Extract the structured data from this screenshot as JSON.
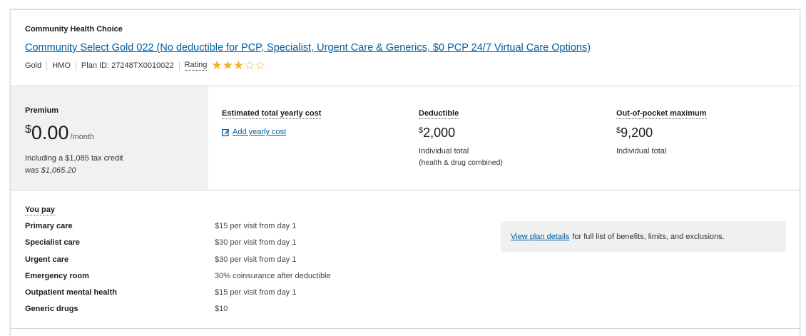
{
  "header": {
    "issuer": "Community Health Choice",
    "plan_name": "Community Select Gold 022 (No deductible for PCP, Specialist, Urgent Care & Generics, $0 PCP 24/7 Virtual Care Options)",
    "metal_level": "Gold",
    "plan_type": "HMO",
    "plan_id": "Plan ID: 27248TX0010022",
    "rating_label": "Rating",
    "rating_value": 3,
    "rating_max": 5,
    "star_color": "#f0b323"
  },
  "premium": {
    "label": "Premium",
    "currency": "$",
    "amount": "0.00",
    "period": "/month",
    "tax_credit": "Including a $1,085 tax credit",
    "was": "was $1,065.20"
  },
  "costs": {
    "yearly": {
      "label": "Estimated total yearly cost",
      "action": "Add yearly cost",
      "icon": "edit-icon"
    },
    "deductible": {
      "label": "Deductible",
      "currency": "$",
      "amount": "2,000",
      "sub1": "Individual total",
      "sub2": "(health & drug combined)"
    },
    "oop": {
      "label": "Out-of-pocket maximum",
      "currency": "$",
      "amount": "9,200",
      "sub1": "Individual total"
    }
  },
  "you_pay": {
    "title": "You pay",
    "rows": [
      {
        "name": "Primary care",
        "value": "$15 per visit from day 1"
      },
      {
        "name": "Specialist care",
        "value": "$30 per visit from day 1"
      },
      {
        "name": "Urgent care",
        "value": "$30 per visit from day 1"
      },
      {
        "name": "Emergency room",
        "value": "30% coinsurance after deductible"
      },
      {
        "name": "Outpatient mental health",
        "value": "$15 per visit from day 1"
      },
      {
        "name": "Generic drugs",
        "value": "$10"
      }
    ],
    "details_link": "View plan details",
    "details_text": "for full list of benefits, limits, and exclusions."
  },
  "colors": {
    "link": "#005ea2",
    "premium_bg": "#f1f1f1",
    "border": "#d6d6d6"
  }
}
